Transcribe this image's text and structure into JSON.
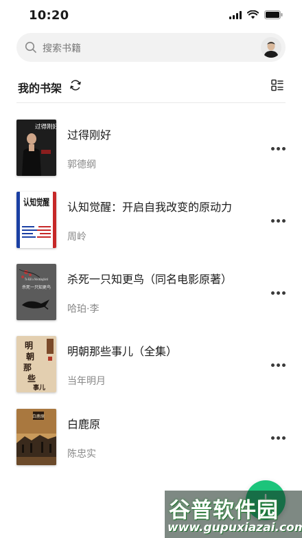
{
  "status_bar": {
    "time": "10:20"
  },
  "search": {
    "placeholder": "搜索书籍"
  },
  "shelf": {
    "title": "我的书架"
  },
  "books": [
    {
      "title": "过得刚好",
      "author": "郭德纲"
    },
    {
      "title": "认知觉醒：开启自我改变的原动力",
      "author": "周岭"
    },
    {
      "title": "杀死一只知更鸟（同名电影原著）",
      "author": "哈珀·李"
    },
    {
      "title": "明朝那些事儿（全集）",
      "author": "当年明月"
    },
    {
      "title": "白鹿原",
      "author": "陈忠实"
    }
  ],
  "covers": {
    "b0": {
      "text": "过得刚好"
    },
    "b1": {
      "text": "认知觉醒"
    },
    "b2": {
      "text_en": "To Kill a Mockingbird",
      "text": "杀死一只知更鸟"
    },
    "b3": {
      "text": "明朝那些事儿"
    },
    "b4": {
      "text": "白鹿原"
    }
  },
  "watermark": {
    "logo": "谷普软件园",
    "url": "www.gupuxiazai.com"
  },
  "colors": {
    "accent": "#1cc47b",
    "search_bg": "#f2f2f2",
    "author_gray": "#888888"
  },
  "icons": [
    "search-icon",
    "avatar",
    "sync-icon",
    "list-view-icon",
    "more-icon",
    "add-icon"
  ]
}
